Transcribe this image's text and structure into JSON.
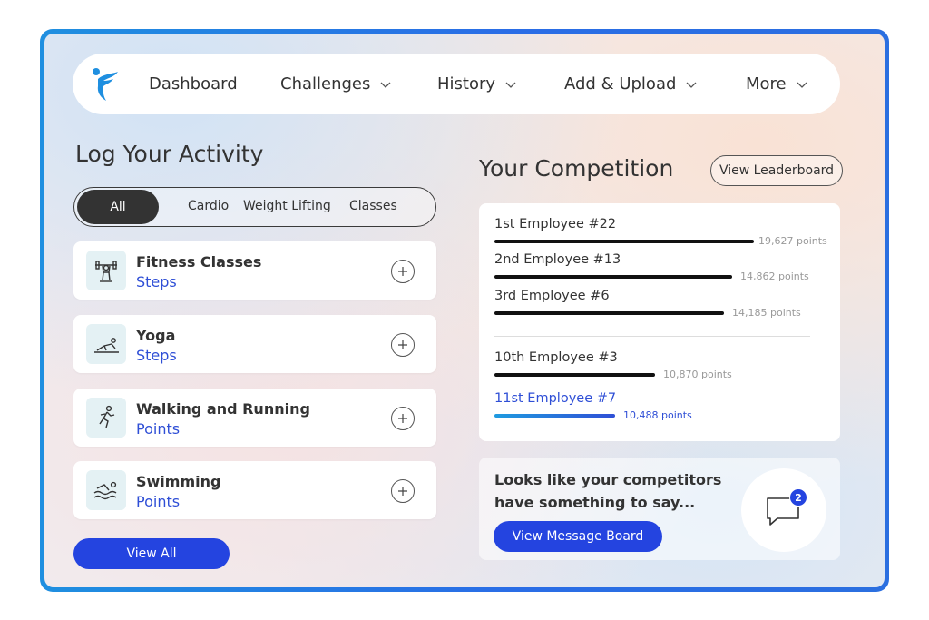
{
  "nav": {
    "items": [
      {
        "label": "Dashboard",
        "dropdown": false
      },
      {
        "label": "Challenges",
        "dropdown": true
      },
      {
        "label": "History",
        "dropdown": true
      },
      {
        "label": "Add & Upload",
        "dropdown": true
      },
      {
        "label": "More",
        "dropdown": true
      }
    ]
  },
  "log": {
    "title": "Log Your Activity",
    "filters": {
      "all": "All",
      "cardio": "Cardio",
      "weight": "Weight Lifting",
      "classes": "Classes"
    },
    "activities": [
      {
        "name": "Fitness Classes",
        "unit": "Steps",
        "icon": "fitness-class-icon"
      },
      {
        "name": "Yoga",
        "unit": "Steps",
        "icon": "yoga-icon"
      },
      {
        "name": "Walking and Running",
        "unit": "Points",
        "icon": "running-icon"
      },
      {
        "name": "Swimming",
        "unit": "Points",
        "icon": "swimming-icon"
      }
    ],
    "view_all": "View All"
  },
  "competition": {
    "title": "Your Competition",
    "leaderboard_button": "View Leaderboard",
    "ranks": [
      {
        "name": "1st Employee #22",
        "points": "19,627 points",
        "value": 19627
      },
      {
        "name": "2nd Employee #13",
        "points": "14,862 points",
        "value": 14862
      },
      {
        "name": "3rd Employee #6",
        "points": "14,185 points",
        "value": 14185
      },
      {
        "name": "10th Employee #3",
        "points": "10,870 points",
        "value": 10870
      },
      {
        "name": "11st Employee #7",
        "points": "10,488 points",
        "value": 10488
      }
    ]
  },
  "messages": {
    "text": "Looks like your competitors have something to say...",
    "button": "View Message Board",
    "badge": "2"
  },
  "colors": {
    "accent": "#2444e0",
    "frame": "#2a6de6",
    "text": "#333333"
  }
}
